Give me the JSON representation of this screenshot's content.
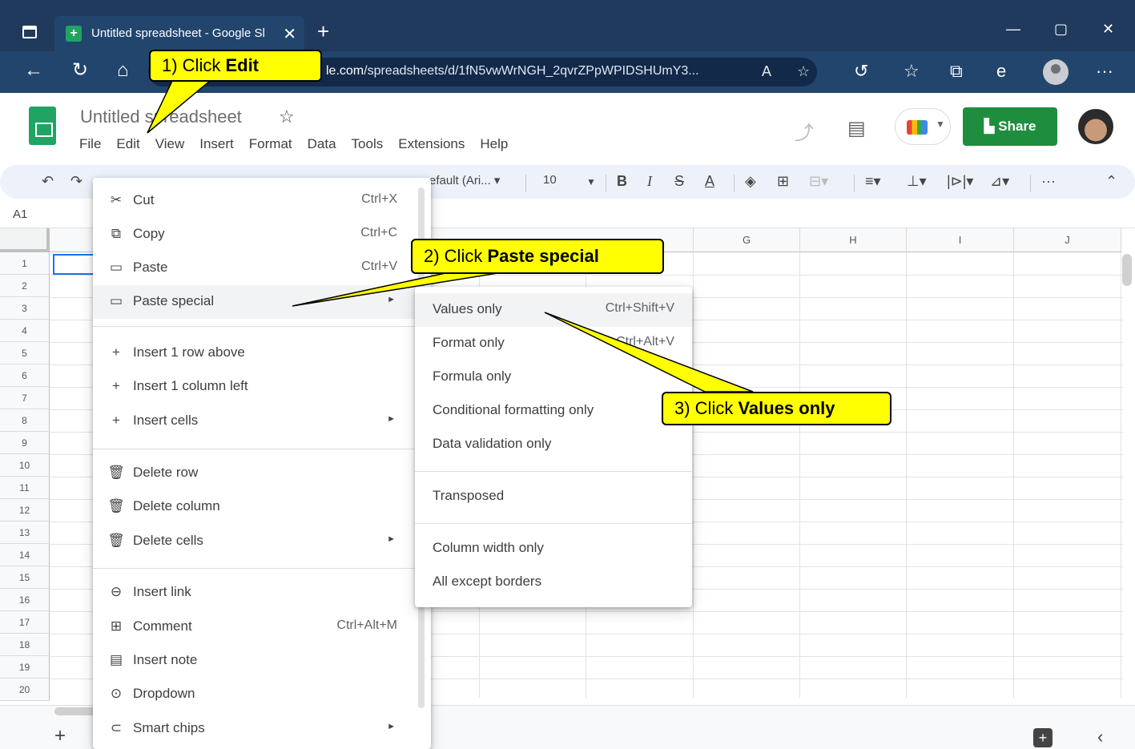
{
  "browser": {
    "tab_title": "Untitled spreadsheet - Google Sl",
    "tab_close": "✕",
    "new_tab": "+",
    "url_prefix": "le.com",
    "url_rest": "/spreadsheets/d/1fN5vwWrNGH_2qvrZPpWPIDSHUmY3...",
    "minimize": "—",
    "maximize": "▢",
    "close": "✕",
    "more": "···"
  },
  "sheets": {
    "doc_title": "Untitled spreadsheet",
    "menu": [
      "File",
      "Edit",
      "View",
      "Insert",
      "Format",
      "Data",
      "Tools",
      "Extensions",
      "Help"
    ],
    "share_label": "Share",
    "font_name": "efault (Ari...",
    "font_size": "10",
    "name_box": "A1"
  },
  "columns": [
    "G",
    "H",
    "I",
    "J"
  ],
  "rows": [
    "1",
    "2",
    "3",
    "4",
    "5",
    "6",
    "7",
    "8",
    "9",
    "10",
    "11",
    "12",
    "13",
    "14",
    "15",
    "16",
    "17",
    "18",
    "19",
    "20"
  ],
  "edit_menu": {
    "items": [
      {
        "label": "Cut",
        "shortcut": "Ctrl+X",
        "icon": "cut-icon"
      },
      {
        "label": "Copy",
        "shortcut": "Ctrl+C",
        "icon": "copy-icon"
      },
      {
        "label": "Paste",
        "shortcut": "Ctrl+V",
        "icon": "paste-icon"
      },
      {
        "label": "Paste special",
        "shortcut": "",
        "icon": "paste-icon"
      },
      {
        "label": "Insert 1 row above",
        "shortcut": "",
        "icon": "plus-icon"
      },
      {
        "label": "Insert 1 column left",
        "shortcut": "",
        "icon": "plus-icon"
      },
      {
        "label": "Insert cells",
        "shortcut": "",
        "icon": "plus-icon"
      },
      {
        "label": "Delete row",
        "shortcut": "",
        "icon": "trash-icon"
      },
      {
        "label": "Delete column",
        "shortcut": "",
        "icon": "trash-icon"
      },
      {
        "label": "Delete cells",
        "shortcut": "",
        "icon": "trash-icon"
      },
      {
        "label": "Insert link",
        "shortcut": "",
        "icon": "link-icon"
      },
      {
        "label": "Comment",
        "shortcut": "Ctrl+Alt+M",
        "icon": "comment-icon"
      },
      {
        "label": "Insert note",
        "shortcut": "",
        "icon": "note-icon"
      },
      {
        "label": "Dropdown",
        "shortcut": "",
        "icon": "dropdown-icon"
      },
      {
        "label": "Smart chips",
        "shortcut": "",
        "icon": "chips-icon"
      }
    ]
  },
  "paste_special_menu": {
    "items": [
      {
        "label": "Values only",
        "shortcut": "Ctrl+Shift+V"
      },
      {
        "label": "Format only",
        "shortcut": "Ctrl+Alt+V"
      },
      {
        "label": "Formula only",
        "shortcut": ""
      },
      {
        "label": "Conditional formatting only",
        "shortcut": ""
      },
      {
        "label": "Data validation only",
        "shortcut": ""
      },
      {
        "label": "Transposed",
        "shortcut": ""
      },
      {
        "label": "Column width only",
        "shortcut": ""
      },
      {
        "label": "All except borders",
        "shortcut": ""
      }
    ]
  },
  "callouts": {
    "step1_prefix": "1)  Click ",
    "step1_bold": "Edit",
    "step2_prefix": "2)  Click ",
    "step2_bold": "Paste special",
    "step3_prefix": "3)  Click ",
    "step3_bold": "Values only"
  },
  "colors": {
    "callout": "#ffff00",
    "share": "#1e8e3e",
    "selection": "#1a73e8",
    "browser": "#1f3a5c"
  }
}
